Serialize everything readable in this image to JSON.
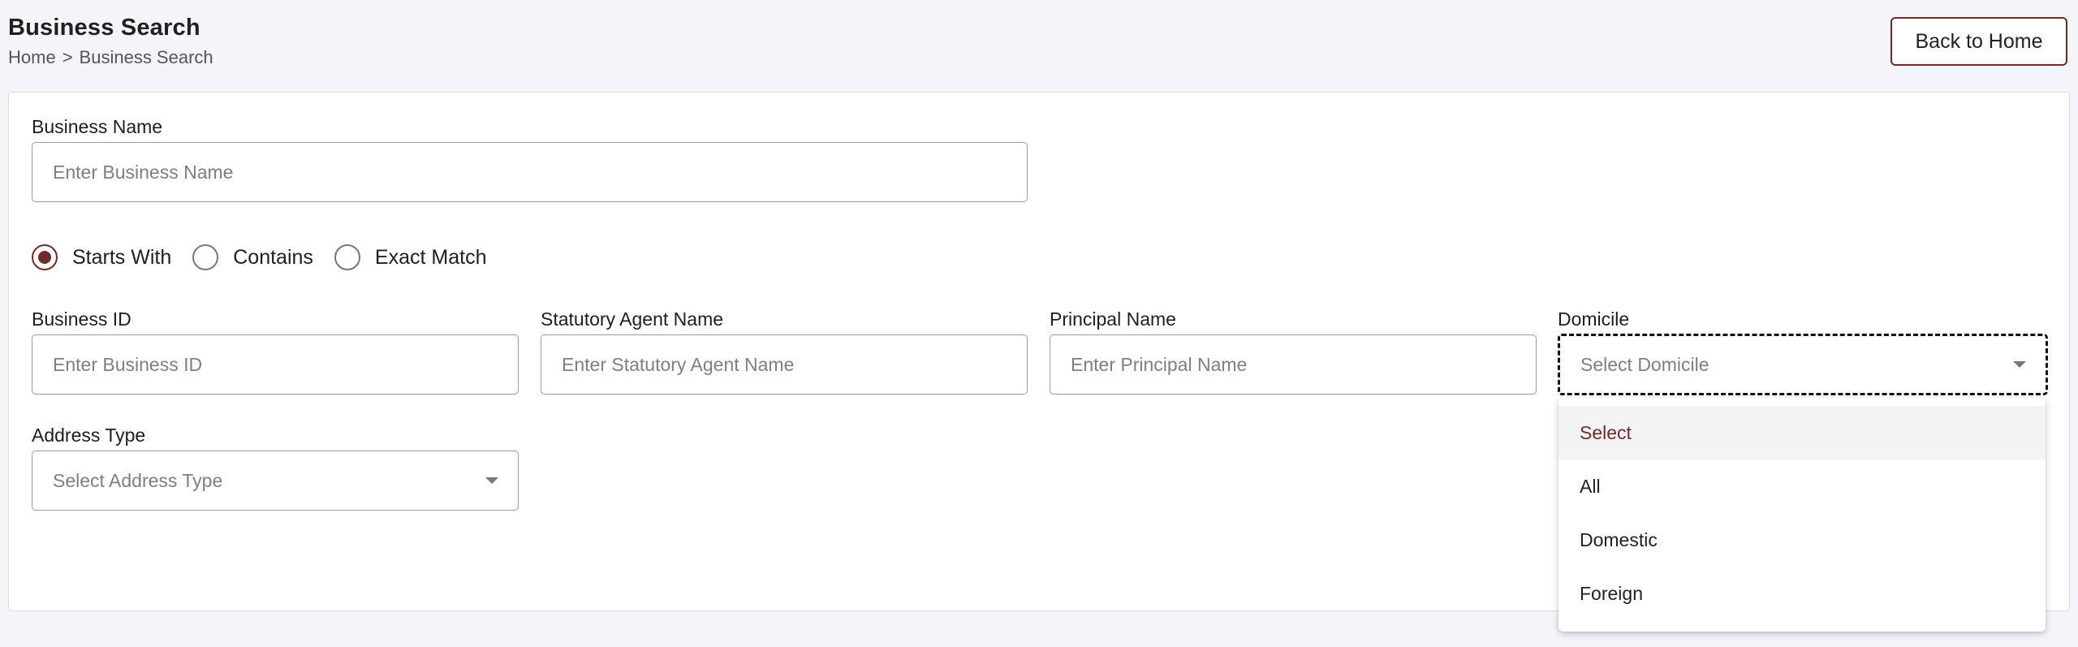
{
  "header": {
    "title": "Business Search",
    "breadcrumb": {
      "home": "Home",
      "separator": ">",
      "current": "Business Search"
    },
    "back_button": "Back to Home"
  },
  "form": {
    "business_name": {
      "label": "Business Name",
      "placeholder": "Enter Business Name",
      "value": ""
    },
    "match_options": {
      "selected": "Starts With",
      "options": [
        "Starts With",
        "Contains",
        "Exact Match"
      ]
    },
    "business_id": {
      "label": "Business ID",
      "placeholder": "Enter Business ID",
      "value": ""
    },
    "statutory_agent": {
      "label": "Statutory Agent Name",
      "placeholder": "Enter Statutory Agent Name",
      "value": ""
    },
    "principal_name": {
      "label": "Principal Name",
      "placeholder": "Enter Principal Name",
      "value": ""
    },
    "domicile": {
      "label": "Domicile",
      "placeholder": "Select Domicile",
      "options": [
        "Select",
        "All",
        "Domestic",
        "Foreign"
      ],
      "highlighted": "Select"
    },
    "address_type": {
      "label": "Address Type",
      "placeholder": "Select Address Type"
    }
  },
  "colors": {
    "accent": "#6e2b2b",
    "background": "#f4f5f8",
    "border": "#9a9a9a"
  },
  "icons": {
    "select_caret": "chevron-down-icon",
    "radio_selected": "radio-checked-icon",
    "radio_unselected": "radio-unchecked-icon"
  }
}
